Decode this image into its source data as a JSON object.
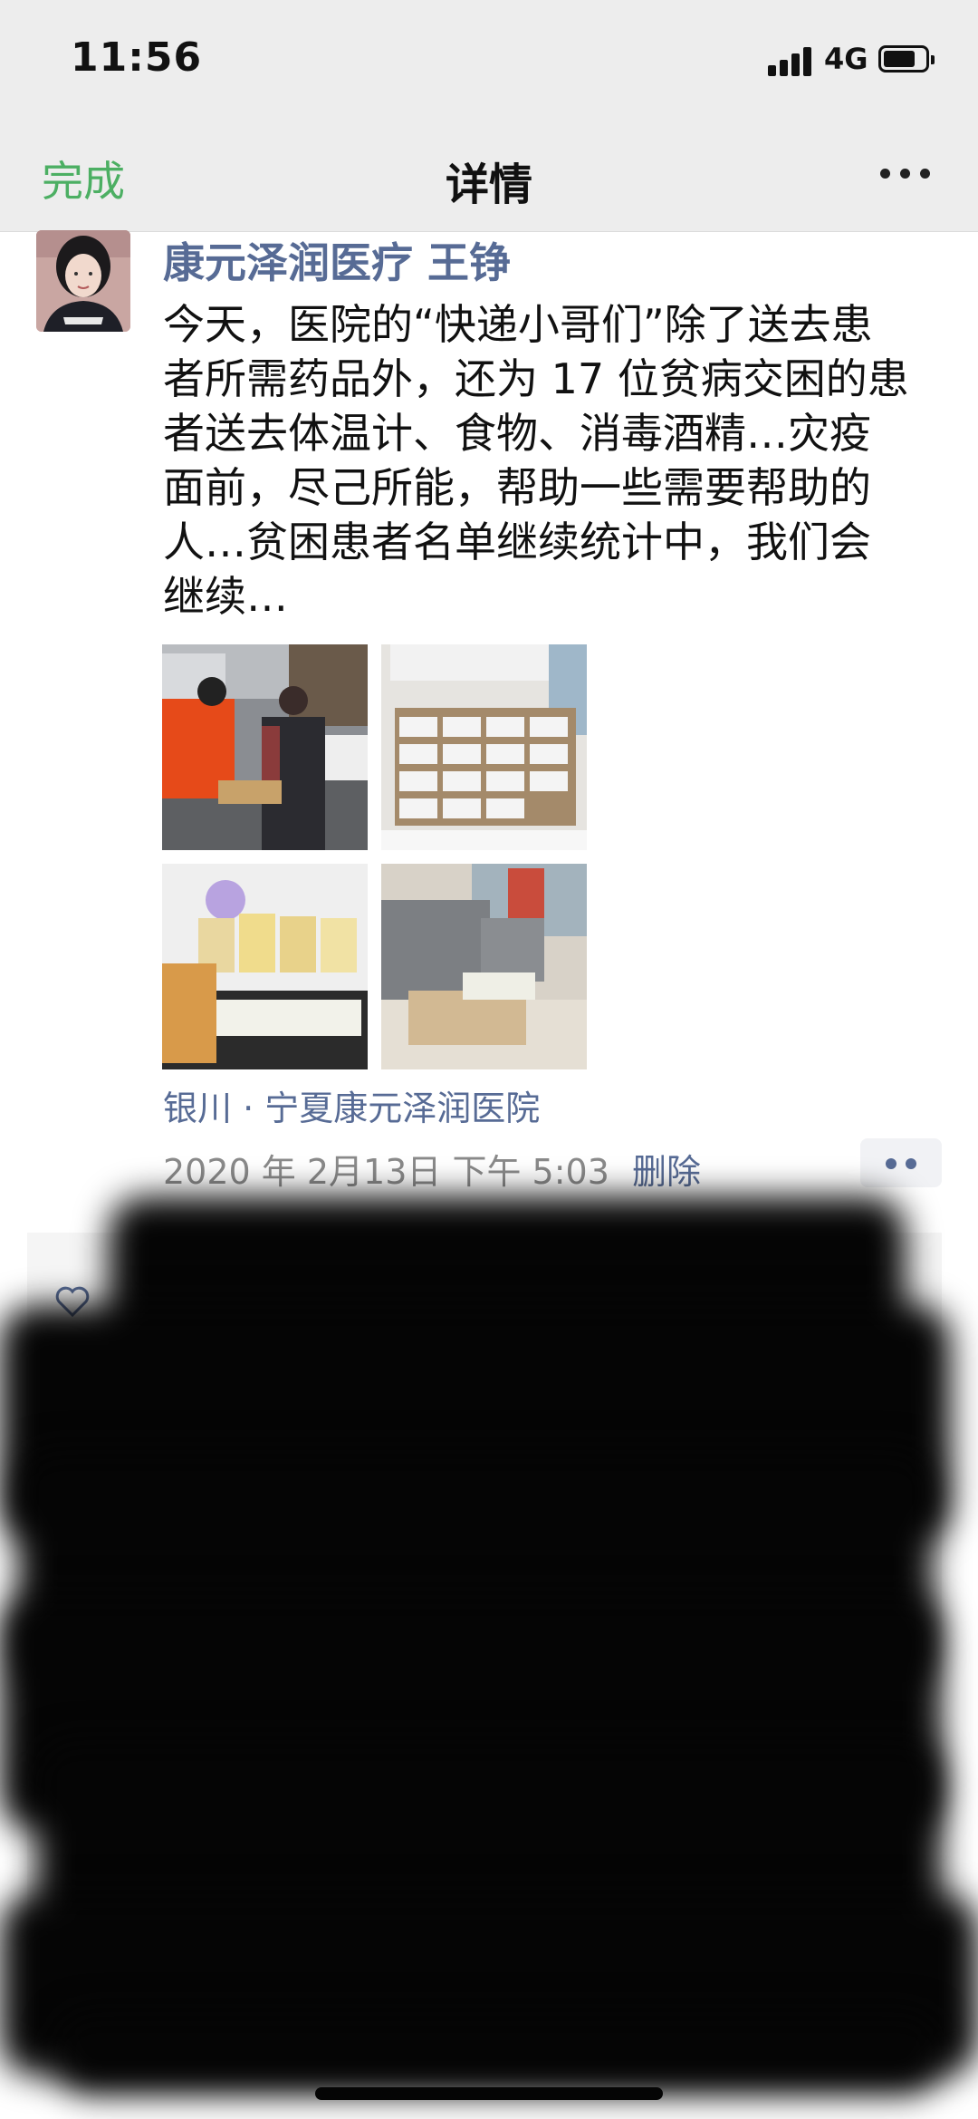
{
  "status_bar": {
    "time": "11:56",
    "network": "4G"
  },
  "nav": {
    "done_label": "完成",
    "title": "详情",
    "more_icon": "more-dots-icon"
  },
  "post": {
    "author": "康元泽润医疗  王铮",
    "text_lines": [
      "今天，医院的“快递小哥们”除了送去患",
      "者所需药品外，还为 17 位贫病交困的患",
      "者送去体温计、食物、消毒酒精…灾疫",
      "面前，尽己所能，帮助一些需要帮助的",
      "人…贫困患者名单继续统计中，我们会",
      "继续…"
    ],
    "location": "银川 · 宁夏康元泽润医院",
    "timestamp": "2020 年 2月13日 下午 5:03",
    "delete_label": "删除"
  },
  "colors": {
    "accent_green": "#4caf63",
    "link_blue": "#576b95",
    "nav_bg": "#ededed"
  }
}
